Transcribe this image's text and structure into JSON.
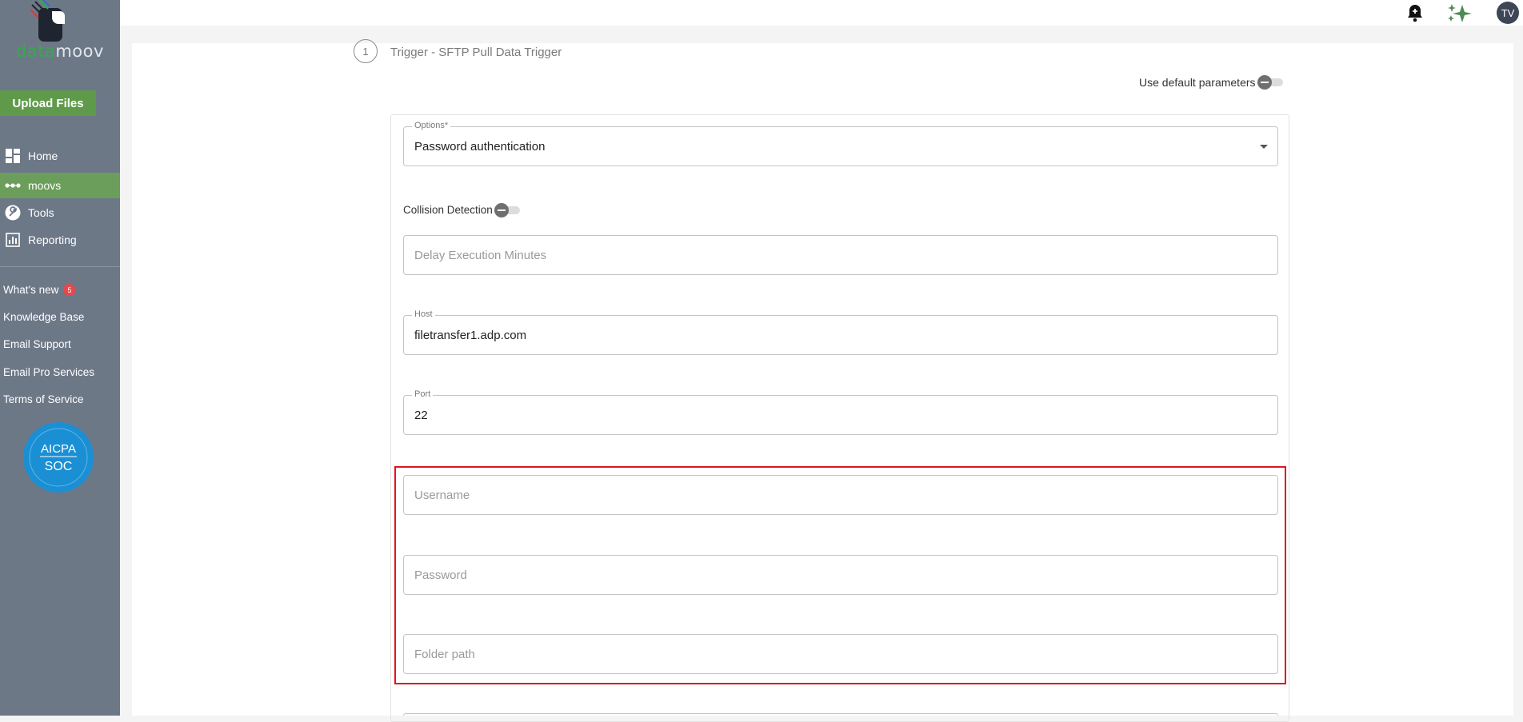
{
  "brand": {
    "logo_part1": "data",
    "logo_part2": "moov"
  },
  "sidebar": {
    "upload_label": "Upload Files",
    "nav": [
      {
        "label": "Home",
        "icon": "dashboard-icon"
      },
      {
        "label": "moovs",
        "icon": "dots-icon",
        "active": true
      },
      {
        "label": "Tools",
        "icon": "wrench-icon"
      },
      {
        "label": "Reporting",
        "icon": "bar-chart-icon"
      }
    ],
    "links": [
      {
        "label": "What's new",
        "badge": "5"
      },
      {
        "label": "Knowledge Base"
      },
      {
        "label": "Email Support"
      },
      {
        "label": "Email Pro Services"
      },
      {
        "label": "Terms of Service"
      }
    ],
    "badge_logo": {
      "line1": "AICPA",
      "line2": "SOC"
    }
  },
  "topbar": {
    "icons": [
      "bell-plus-icon",
      "sparkle-icon"
    ],
    "avatar_initials": "TV"
  },
  "step": {
    "number": "1",
    "title": "Trigger - SFTP Pull Data Trigger"
  },
  "form": {
    "use_default_label": "Use default parameters",
    "options": {
      "legend": "Options*",
      "value": "Password authentication"
    },
    "collision_label": "Collision Detection",
    "delay": {
      "placeholder": "Delay Execution Minutes"
    },
    "host": {
      "legend": "Host",
      "value": "filetransfer1.adp.com"
    },
    "port": {
      "legend": "Port",
      "value": "22"
    },
    "username": {
      "placeholder": "Username"
    },
    "password": {
      "placeholder": "Password"
    },
    "folder": {
      "placeholder": "Folder path"
    }
  },
  "colors": {
    "sidebar_bg": "#6d7887",
    "accent_green": "#5f9a4b",
    "highlight_red": "#e0151e"
  }
}
